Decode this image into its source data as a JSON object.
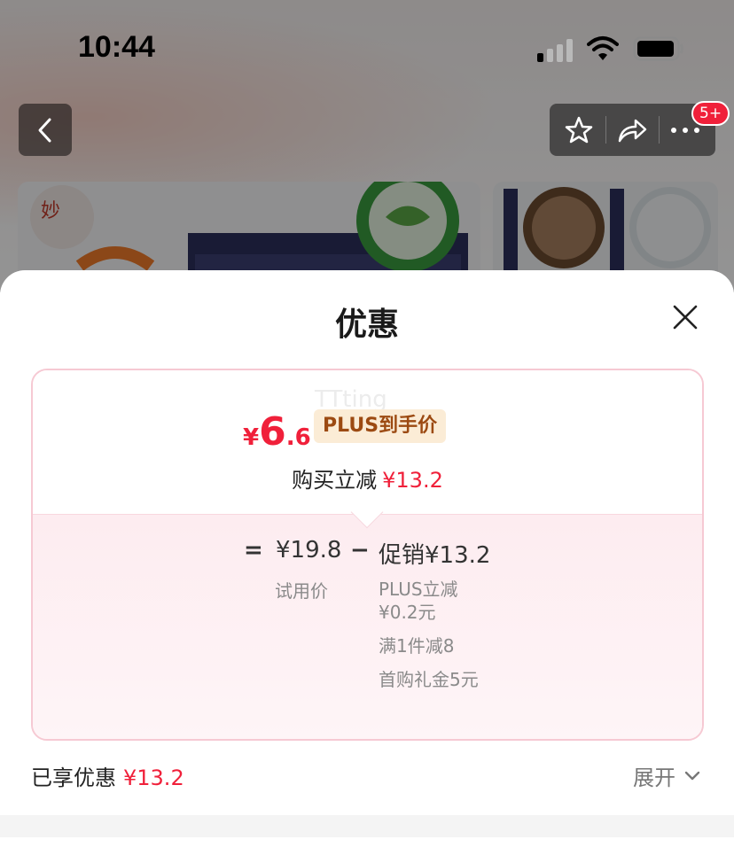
{
  "status_bar": {
    "time": "10:44"
  },
  "nav": {
    "badge": "5+"
  },
  "sheet": {
    "title": "优惠",
    "watermark": "TTting",
    "final_price": {
      "currency": "¥",
      "integer": "6",
      "decimal": ".6"
    },
    "plus_tag": "PLUS到手价",
    "reduce_label": "购买立减",
    "reduce_value": "¥13.2",
    "formula": {
      "equals": "=",
      "base_price": "¥19.8",
      "minus": "−",
      "promo": "促销¥13.2"
    },
    "trial_label": "试用价",
    "details": [
      "PLUS立减¥0.2元",
      "满1件减8",
      "首购礼金5元"
    ],
    "saved_label": "已享优惠",
    "saved_value": "¥13.2",
    "expand_label": "展开"
  },
  "colors": {
    "accent_red": "#f0203a",
    "plus_gold_bg": "#fbecd6",
    "card_border": "#f6c9d3"
  }
}
